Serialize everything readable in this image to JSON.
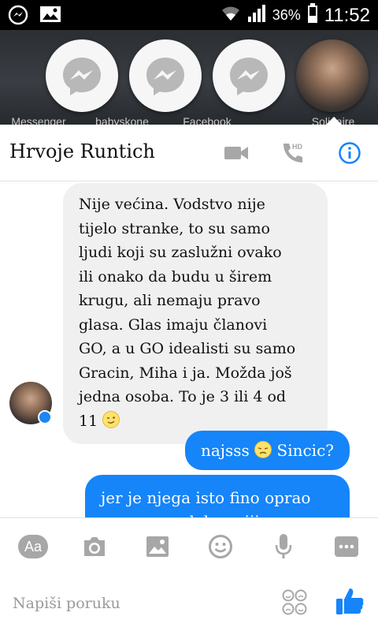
{
  "status_bar": {
    "time": "11:52",
    "battery_percent": "36%"
  },
  "chat_heads": [
    {
      "label": "Messenger",
      "icon": "messenger-icon"
    },
    {
      "label": "babyskone",
      "icon": "messenger-icon"
    },
    {
      "label": "Facebook",
      "icon": "messenger-icon"
    },
    {
      "label": "Solidaire",
      "icon": "profile-photo"
    }
  ],
  "header": {
    "title": "Hrvoje Runtich",
    "icons": [
      "video-call-icon",
      "hd-call-icon",
      "info-icon"
    ]
  },
  "messages": {
    "incoming": [
      "Nije većina. Vodstvo nije",
      "tijelo stranke, to su samo",
      "ljudi koji su zaslužni ovako",
      "ili onako da budu u širem",
      "krugu, ali nemaju pravo",
      "glasa. Glas imaju članovi",
      "GO, a u GO idealisti su samo",
      "Gracin, Miha i ja. Možda još",
      "jedna osoba. To je 3 ili 4 od",
      "11"
    ],
    "outgoing_1_prefix": "najsss",
    "outgoing_1_suffix": "Sincic?",
    "outgoing_2_line1": "jer je njega isto fino oprao",
    "outgoing_2_line2": "parpar na delezaciji"
  },
  "toolbar": {
    "aa_label": "Aa",
    "icons": [
      "camera-icon",
      "gallery-icon",
      "emoji-icon",
      "microphone-icon",
      "more-icon"
    ]
  },
  "composer": {
    "placeholder": "Napiši poruku"
  },
  "colors": {
    "accent": "#1585f9",
    "incoming_bubble": "#f1f0f0",
    "icon_gray": "#a7a7a7"
  }
}
